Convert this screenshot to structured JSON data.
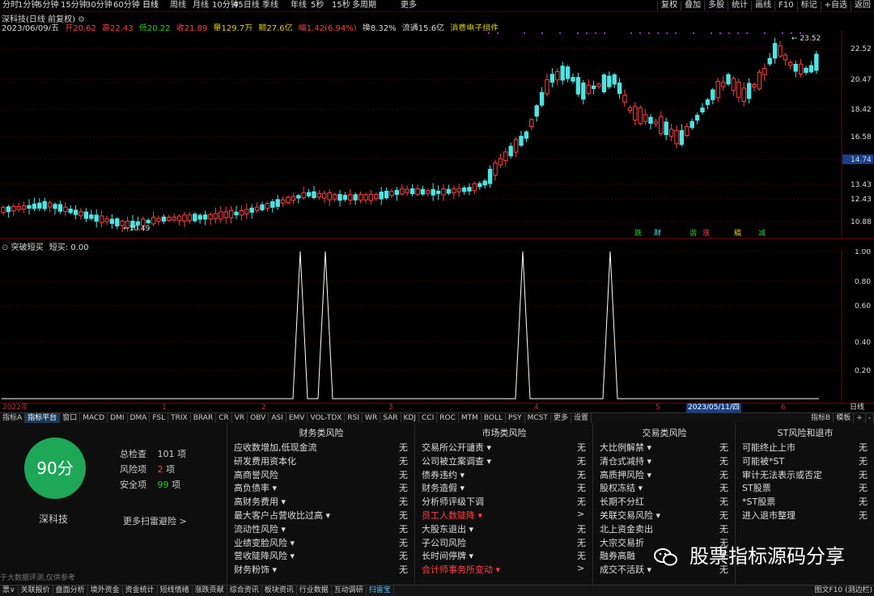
{
  "periods": [
    "分时",
    "1分钟",
    "5分钟",
    "15分钟",
    "30分钟",
    "60分钟",
    "日线",
    "周线",
    "月线",
    "10分钟",
    "45日线",
    "季线",
    "年线",
    "5秒",
    "15秒",
    "多周期",
    "更多"
  ],
  "active_period": "日线",
  "top_buttons": [
    "复权",
    "叠加",
    "多股",
    "统计",
    "画线",
    "F10",
    "标记",
    "+自选",
    "返回"
  ],
  "title": "深科技(日线 前复权)",
  "quote": {
    "date": "2023/06/09/五",
    "open": "开20.62",
    "high": "高22.43",
    "low": "低20.22",
    "close": "收21.89",
    "volume": "量129.7万",
    "amount": "额27.6亿",
    "change": "幅1.42(6.94%)",
    "turnover": "换8.32%",
    "float": "流通15.6亿",
    "concept": "消费电子组件"
  },
  "price_axis": [
    "22.52",
    "20.47",
    "18.42",
    "16.58",
    "14.74",
    "13.43",
    "12.43",
    "10.88"
  ],
  "price_axis_highlight": "14.74",
  "annotations": {
    "high": "23.52",
    "low": "10.49"
  },
  "signals": [
    {
      "text": "跌",
      "color": "#21d221"
    },
    {
      "text": "财",
      "color": "#4fe3e3"
    },
    {
      "text": "谐",
      "color": "#21d221"
    },
    {
      "text": "涨",
      "color": "#ff4040"
    },
    {
      "text": "稿",
      "color": "#e0d000"
    },
    {
      "text": "减",
      "color": "#21d221"
    }
  ],
  "indicator": {
    "name": "突破短买",
    "label": "短买: 0.00"
  },
  "ind_axis": [
    "1.00",
    "0.80",
    "0.60",
    "0.40",
    "0.20"
  ],
  "dates": [
    "2022年",
    "1",
    "2",
    "3",
    "4",
    "5",
    "2023/05/11/四",
    "6"
  ],
  "date_right": "日线",
  "ind_tabs": [
    "指标A",
    "指标平台",
    "窗口",
    "MACD",
    "DMI",
    "DMA",
    "FSL",
    "TRIX",
    "BRAR",
    "CR",
    "VR",
    "OBV",
    "ASI",
    "EMV",
    "VOL-TDX",
    "RSI",
    "WR",
    "SAR",
    "KDJ",
    "CCI",
    "ROC",
    "MTM",
    "BOLL",
    "PSY",
    "MCST",
    "更多",
    "设置"
  ],
  "ind_tabs_right": [
    "指标B",
    "模板",
    "+",
    "-"
  ],
  "score": {
    "value": "90分",
    "name": "深科技",
    "total_label": "总检查",
    "total": "101",
    "unit": "项",
    "risk_label": "风险项",
    "risk": "2",
    "safe_label": "安全项",
    "safe": "99",
    "more": "更多扫雷避险 >",
    "note": "于大数据评测,仅供参考"
  },
  "risk_columns": [
    {
      "title": "财务类风险",
      "rows": [
        {
          "label": "应收数增加,低现金流",
          "value": "无",
          "red": false
        },
        {
          "label": "研发费用资本化",
          "value": "无",
          "red": false
        },
        {
          "label": "高商誉风险",
          "value": "无",
          "red": false
        },
        {
          "label": "高负债率 ▾",
          "value": "无",
          "red": false
        },
        {
          "label": "高财务费用 ▾",
          "value": "无",
          "red": false
        },
        {
          "label": "最大客户占营收比过高 ▾",
          "value": "无",
          "red": false
        },
        {
          "label": "流动性风险 ▾",
          "value": "无",
          "red": false
        },
        {
          "label": "业绩变脸风险 ▾",
          "value": "无",
          "red": false
        },
        {
          "label": "营收陡降风险 ▾",
          "value": "无",
          "red": false
        },
        {
          "label": "财务粉饰 ▾",
          "value": "无",
          "red": false
        }
      ]
    },
    {
      "title": "市场类风险",
      "rows": [
        {
          "label": "交易所公开谴责 ▾",
          "value": "无",
          "red": false
        },
        {
          "label": "公司被立案调查 ▾",
          "value": "无",
          "red": false
        },
        {
          "label": "债券违约 ▾",
          "value": "无",
          "red": false
        },
        {
          "label": "财务造假 ▾",
          "value": "无",
          "red": false
        },
        {
          "label": "分析师评级下调",
          "value": "无",
          "red": false
        },
        {
          "label": "员工人数陡降 ▾",
          "value": ">",
          "red": true
        },
        {
          "label": "大股东退出 ▾",
          "value": "无",
          "red": false
        },
        {
          "label": "子公司风险",
          "value": "无",
          "red": false
        },
        {
          "label": "长时间停牌 ▾",
          "value": "无",
          "red": false
        },
        {
          "label": "会计师事务所变动 ▾",
          "value": ">",
          "red": true
        }
      ]
    },
    {
      "title": "交易类风险",
      "rows": [
        {
          "label": "大比例解禁 ▾",
          "value": "无",
          "red": false
        },
        {
          "label": "清仓式减持 ▾",
          "value": "无",
          "red": false
        },
        {
          "label": "高质押风险 ▾",
          "value": "无",
          "red": false
        },
        {
          "label": "股权冻结 ▾",
          "value": "无",
          "red": false
        },
        {
          "label": "长期不分红",
          "value": "无",
          "red": false
        },
        {
          "label": "关联交易风险 ▾",
          "value": "无",
          "red": false
        },
        {
          "label": "北上资金卖出",
          "value": "无",
          "red": false
        },
        {
          "label": "大宗交易折",
          "value": "无",
          "red": false
        },
        {
          "label": "融券高融",
          "value": "无",
          "red": false
        },
        {
          "label": "成交不活跃 ▾",
          "value": "无",
          "red": false
        }
      ]
    },
    {
      "title": "ST风险和退市",
      "rows": [
        {
          "label": "可能终止上市",
          "value": "无",
          "red": false
        },
        {
          "label": "可能被*ST",
          "value": "无",
          "red": false
        },
        {
          "label": "审计无法表示或否定",
          "value": "无",
          "red": false
        },
        {
          "label": "ST股票",
          "value": "无",
          "red": false
        },
        {
          "label": "*ST股票",
          "value": "无",
          "red": false
        },
        {
          "label": "进入退市整理",
          "value": "无",
          "red": false
        }
      ]
    }
  ],
  "bottom_tabs": [
    "票∨",
    "关联报价",
    "盘面分析",
    "境外资金",
    "资金统计",
    "短线情绪",
    "涨跌贡献",
    "综合资讯",
    "板块资讯",
    "行业数据",
    "互动调研",
    "扫雷宝"
  ],
  "bottom_active": "扫雷宝",
  "bottom_right": "图文F10 (测边栏)",
  "watermark": "股票指标源码分享",
  "colors": {
    "up": "#ff4040",
    "down": "#4fe3e3",
    "score": "#1fa758",
    "border": "#700000"
  }
}
